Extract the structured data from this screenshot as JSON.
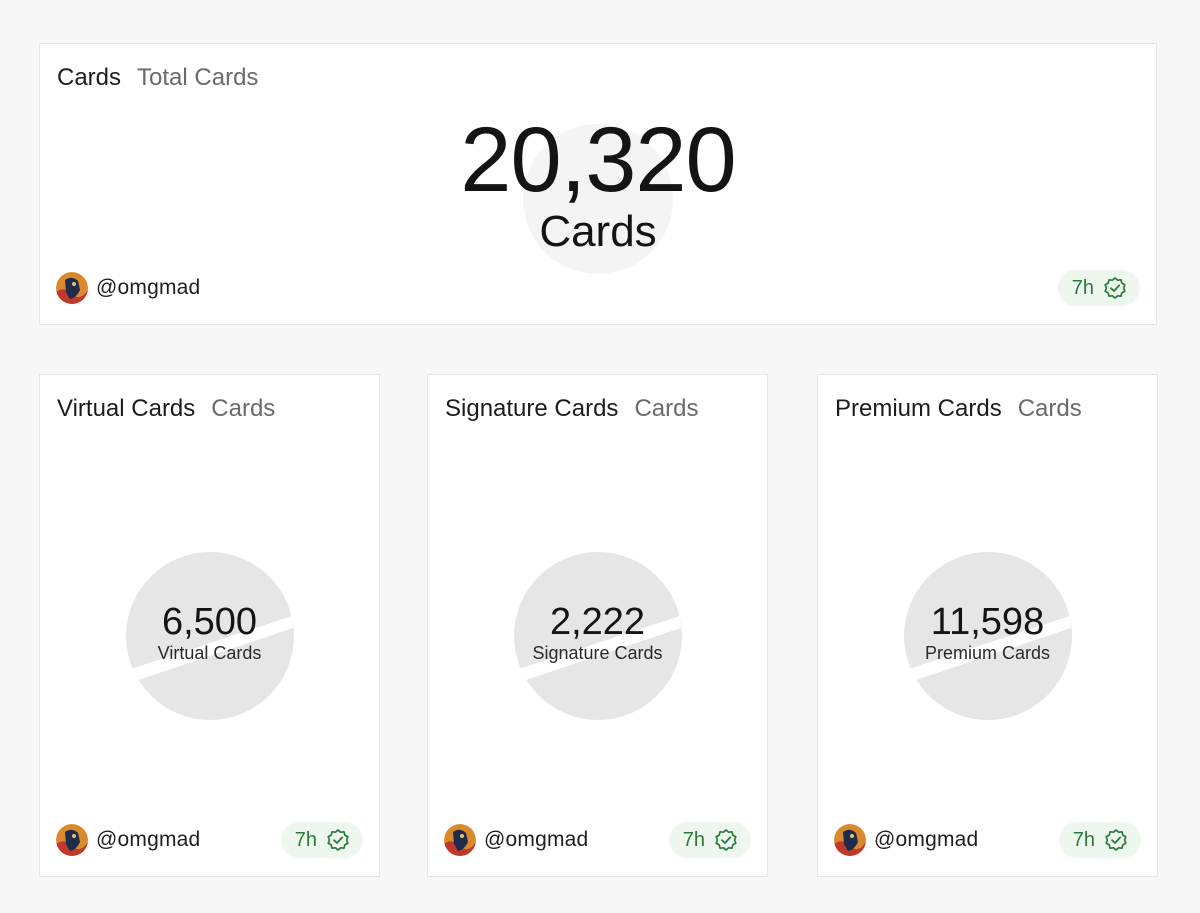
{
  "total": {
    "title": "Cards",
    "subtitle": "Total Cards",
    "value": "20,320",
    "unit": "Cards",
    "user": "@omgmad",
    "time": "7h"
  },
  "cards": [
    {
      "title": "Virtual Cards",
      "subtitle": "Cards",
      "value": "6,500",
      "label": "Virtual Cards",
      "user": "@omgmad",
      "time": "7h"
    },
    {
      "title": "Signature Cards",
      "subtitle": "Cards",
      "value": "2,222",
      "label": "Signature Cards",
      "user": "@omgmad",
      "time": "7h"
    },
    {
      "title": "Premium Cards",
      "subtitle": "Cards",
      "value": "11,598",
      "label": "Premium Cards",
      "user": "@omgmad",
      "time": "7h"
    }
  ],
  "icons": {
    "avatar": "avatar-icon",
    "badge": "verified-check-icon"
  },
  "colors": {
    "badge_bg": "#eef7ee",
    "badge_fg": "#2a7a3a",
    "ring_bg": "#e6e6e6"
  }
}
